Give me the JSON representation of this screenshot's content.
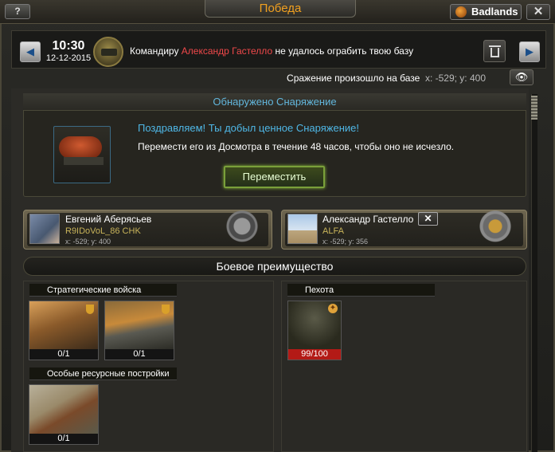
{
  "window": {
    "title": "Победа",
    "help_label": "?",
    "server_label": "Badlands",
    "close_label": "✕"
  },
  "message": {
    "time": "10:30",
    "date": "12-12-2015",
    "text_prefix": "Командиру ",
    "commander_name": "Александр Гастелло",
    "text_suffix": " не удалось ограбить твою базу",
    "prev_label": "◀",
    "next_label": "▶"
  },
  "battle": {
    "text": "Сражение произошло на базе",
    "coords": "x: -529; y: 400",
    "eye_label": "👁"
  },
  "equipment": {
    "header": "Обнаружено Снаряжение",
    "title": "Поздравляем! Ты добыл ценное Снаряжение!",
    "desc": "Перемести его из Досмотра в течение 48 часов, чтобы оно не исчезло.",
    "move_label": "Переместить"
  },
  "players": [
    {
      "name": "Евгений Аберясьев",
      "alliance": "R9IDoVoL_86 CHK",
      "coords": "x: -529; y: 400"
    },
    {
      "name": "Александр Гастелло",
      "alliance": "ALFA",
      "coords": "x: -529; y: 356",
      "x_label": "✕"
    }
  ],
  "advantage": {
    "label": "Боевое преимущество"
  },
  "left_panel": {
    "categories": [
      {
        "title": "Стратегические войска",
        "units": [
          {
            "count": "0/1"
          },
          {
            "count": "0/1"
          }
        ]
      },
      {
        "title": "Особые ресурсные постройки",
        "units": [
          {
            "count": "0/1"
          }
        ]
      }
    ]
  },
  "right_panel": {
    "category": {
      "title": "Пехота",
      "check_label": "✕",
      "units": [
        {
          "count": "99/100"
        }
      ]
    }
  },
  "colors": {
    "accent_orange": "#f0a020",
    "link_blue": "#4fb7e6",
    "name_red": "#f0484a",
    "alliance_gold": "#c9b45a",
    "button_green": "#7aa03a"
  }
}
